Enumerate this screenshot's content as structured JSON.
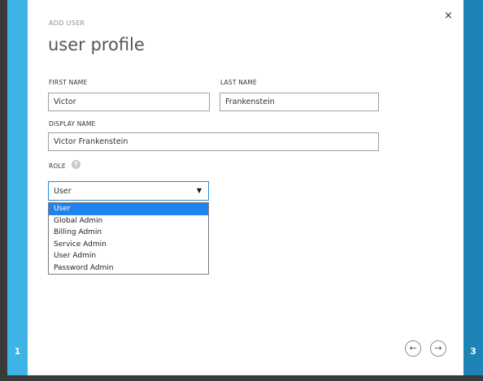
{
  "wizard": {
    "eyebrow": "ADD USER",
    "title": "user profile",
    "close_icon": "×",
    "steps": {
      "left": "1",
      "right": "3"
    }
  },
  "form": {
    "first_name": {
      "label": "FIRST NAME",
      "value": "Victor"
    },
    "last_name": {
      "label": "LAST NAME",
      "value": "Frankenstein"
    },
    "display_name": {
      "label": "DISPLAY NAME",
      "value": "Victor Frankenstein"
    },
    "role": {
      "label": "ROLE",
      "help_icon": "?",
      "selected": "User",
      "options": [
        "User",
        "Global Admin",
        "Billing Admin",
        "Service Admin",
        "User Admin",
        "Password Admin"
      ]
    }
  },
  "navigation": {
    "back_icon": "←",
    "next_icon": "→"
  },
  "colors": {
    "left_panel": "#3db4e5",
    "right_panel": "#1e83b5",
    "selected_option": "#1e83ef"
  }
}
